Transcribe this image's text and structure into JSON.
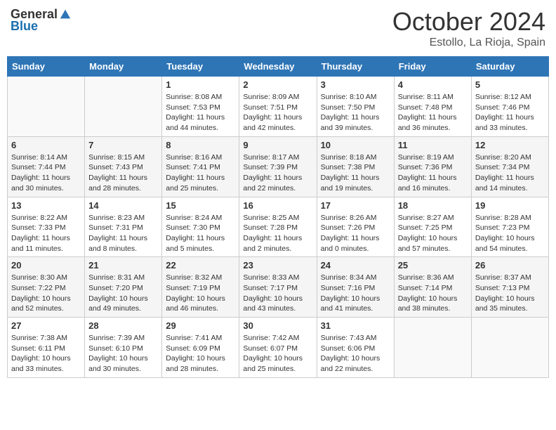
{
  "header": {
    "logo_general": "General",
    "logo_blue": "Blue",
    "month_title": "October 2024",
    "subtitle": "Estollo, La Rioja, Spain"
  },
  "weekdays": [
    "Sunday",
    "Monday",
    "Tuesday",
    "Wednesday",
    "Thursday",
    "Friday",
    "Saturday"
  ],
  "weeks": [
    [
      {
        "day": "",
        "sunrise": "",
        "sunset": "",
        "daylight": ""
      },
      {
        "day": "",
        "sunrise": "",
        "sunset": "",
        "daylight": ""
      },
      {
        "day": "1",
        "sunrise": "Sunrise: 8:08 AM",
        "sunset": "Sunset: 7:53 PM",
        "daylight": "Daylight: 11 hours and 44 minutes."
      },
      {
        "day": "2",
        "sunrise": "Sunrise: 8:09 AM",
        "sunset": "Sunset: 7:51 PM",
        "daylight": "Daylight: 11 hours and 42 minutes."
      },
      {
        "day": "3",
        "sunrise": "Sunrise: 8:10 AM",
        "sunset": "Sunset: 7:50 PM",
        "daylight": "Daylight: 11 hours and 39 minutes."
      },
      {
        "day": "4",
        "sunrise": "Sunrise: 8:11 AM",
        "sunset": "Sunset: 7:48 PM",
        "daylight": "Daylight: 11 hours and 36 minutes."
      },
      {
        "day": "5",
        "sunrise": "Sunrise: 8:12 AM",
        "sunset": "Sunset: 7:46 PM",
        "daylight": "Daylight: 11 hours and 33 minutes."
      }
    ],
    [
      {
        "day": "6",
        "sunrise": "Sunrise: 8:14 AM",
        "sunset": "Sunset: 7:44 PM",
        "daylight": "Daylight: 11 hours and 30 minutes."
      },
      {
        "day": "7",
        "sunrise": "Sunrise: 8:15 AM",
        "sunset": "Sunset: 7:43 PM",
        "daylight": "Daylight: 11 hours and 28 minutes."
      },
      {
        "day": "8",
        "sunrise": "Sunrise: 8:16 AM",
        "sunset": "Sunset: 7:41 PM",
        "daylight": "Daylight: 11 hours and 25 minutes."
      },
      {
        "day": "9",
        "sunrise": "Sunrise: 8:17 AM",
        "sunset": "Sunset: 7:39 PM",
        "daylight": "Daylight: 11 hours and 22 minutes."
      },
      {
        "day": "10",
        "sunrise": "Sunrise: 8:18 AM",
        "sunset": "Sunset: 7:38 PM",
        "daylight": "Daylight: 11 hours and 19 minutes."
      },
      {
        "day": "11",
        "sunrise": "Sunrise: 8:19 AM",
        "sunset": "Sunset: 7:36 PM",
        "daylight": "Daylight: 11 hours and 16 minutes."
      },
      {
        "day": "12",
        "sunrise": "Sunrise: 8:20 AM",
        "sunset": "Sunset: 7:34 PM",
        "daylight": "Daylight: 11 hours and 14 minutes."
      }
    ],
    [
      {
        "day": "13",
        "sunrise": "Sunrise: 8:22 AM",
        "sunset": "Sunset: 7:33 PM",
        "daylight": "Daylight: 11 hours and 11 minutes."
      },
      {
        "day": "14",
        "sunrise": "Sunrise: 8:23 AM",
        "sunset": "Sunset: 7:31 PM",
        "daylight": "Daylight: 11 hours and 8 minutes."
      },
      {
        "day": "15",
        "sunrise": "Sunrise: 8:24 AM",
        "sunset": "Sunset: 7:30 PM",
        "daylight": "Daylight: 11 hours and 5 minutes."
      },
      {
        "day": "16",
        "sunrise": "Sunrise: 8:25 AM",
        "sunset": "Sunset: 7:28 PM",
        "daylight": "Daylight: 11 hours and 2 minutes."
      },
      {
        "day": "17",
        "sunrise": "Sunrise: 8:26 AM",
        "sunset": "Sunset: 7:26 PM",
        "daylight": "Daylight: 11 hours and 0 minutes."
      },
      {
        "day": "18",
        "sunrise": "Sunrise: 8:27 AM",
        "sunset": "Sunset: 7:25 PM",
        "daylight": "Daylight: 10 hours and 57 minutes."
      },
      {
        "day": "19",
        "sunrise": "Sunrise: 8:28 AM",
        "sunset": "Sunset: 7:23 PM",
        "daylight": "Daylight: 10 hours and 54 minutes."
      }
    ],
    [
      {
        "day": "20",
        "sunrise": "Sunrise: 8:30 AM",
        "sunset": "Sunset: 7:22 PM",
        "daylight": "Daylight: 10 hours and 52 minutes."
      },
      {
        "day": "21",
        "sunrise": "Sunrise: 8:31 AM",
        "sunset": "Sunset: 7:20 PM",
        "daylight": "Daylight: 10 hours and 49 minutes."
      },
      {
        "day": "22",
        "sunrise": "Sunrise: 8:32 AM",
        "sunset": "Sunset: 7:19 PM",
        "daylight": "Daylight: 10 hours and 46 minutes."
      },
      {
        "day": "23",
        "sunrise": "Sunrise: 8:33 AM",
        "sunset": "Sunset: 7:17 PM",
        "daylight": "Daylight: 10 hours and 43 minutes."
      },
      {
        "day": "24",
        "sunrise": "Sunrise: 8:34 AM",
        "sunset": "Sunset: 7:16 PM",
        "daylight": "Daylight: 10 hours and 41 minutes."
      },
      {
        "day": "25",
        "sunrise": "Sunrise: 8:36 AM",
        "sunset": "Sunset: 7:14 PM",
        "daylight": "Daylight: 10 hours and 38 minutes."
      },
      {
        "day": "26",
        "sunrise": "Sunrise: 8:37 AM",
        "sunset": "Sunset: 7:13 PM",
        "daylight": "Daylight: 10 hours and 35 minutes."
      }
    ],
    [
      {
        "day": "27",
        "sunrise": "Sunrise: 7:38 AM",
        "sunset": "Sunset: 6:11 PM",
        "daylight": "Daylight: 10 hours and 33 minutes."
      },
      {
        "day": "28",
        "sunrise": "Sunrise: 7:39 AM",
        "sunset": "Sunset: 6:10 PM",
        "daylight": "Daylight: 10 hours and 30 minutes."
      },
      {
        "day": "29",
        "sunrise": "Sunrise: 7:41 AM",
        "sunset": "Sunset: 6:09 PM",
        "daylight": "Daylight: 10 hours and 28 minutes."
      },
      {
        "day": "30",
        "sunrise": "Sunrise: 7:42 AM",
        "sunset": "Sunset: 6:07 PM",
        "daylight": "Daylight: 10 hours and 25 minutes."
      },
      {
        "day": "31",
        "sunrise": "Sunrise: 7:43 AM",
        "sunset": "Sunset: 6:06 PM",
        "daylight": "Daylight: 10 hours and 22 minutes."
      },
      {
        "day": "",
        "sunrise": "",
        "sunset": "",
        "daylight": ""
      },
      {
        "day": "",
        "sunrise": "",
        "sunset": "",
        "daylight": ""
      }
    ]
  ]
}
